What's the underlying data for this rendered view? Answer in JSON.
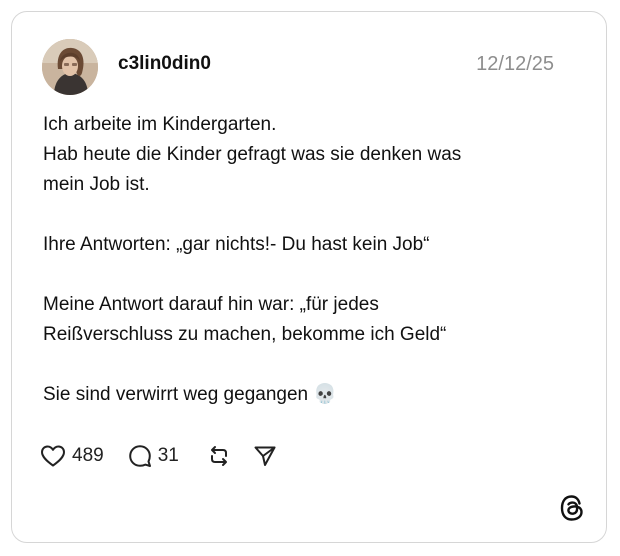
{
  "post": {
    "username": "c3lin0din0",
    "date": "12/12/25",
    "lines": [
      "Ich arbeite im Kindergarten.",
      "Hab heute die Kinder gefragt was sie denken was",
      "mein Job ist.",
      "Ihre Antworten: „gar nichts!- Du hast kein Job“",
      "Meine Antwort darauf hin war: „für jedes",
      "Reißverschluss zu machen, bekomme ich Geld“",
      "Sie sind verwirrt weg gegangen 💀"
    ]
  },
  "actions": {
    "likes": "489",
    "replies": "31",
    "icons": [
      "heart-icon",
      "comment-icon",
      "repost-icon",
      "share-icon"
    ]
  },
  "branding": {
    "icon": "threads-logo-icon"
  },
  "colors": {
    "card_border": "#d6d6d6",
    "text": "#111111",
    "muted": "#8e8e8e",
    "background": "#ffffff"
  }
}
